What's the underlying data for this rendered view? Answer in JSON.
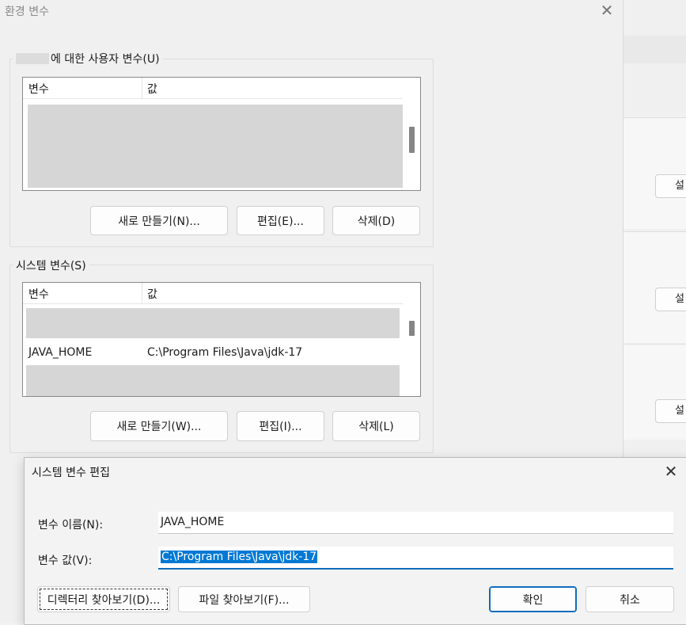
{
  "bg_window": {
    "btn_label": "설"
  },
  "env_dialog": {
    "title": "환경 변수",
    "user_vars": {
      "group_label": "에 대한 사용자 변수(U)",
      "header": {
        "name": "변수",
        "value": "값"
      },
      "buttons": {
        "new": "새로 만들기(N)...",
        "edit": "편집(E)...",
        "delete": "삭제(D)"
      }
    },
    "sys_vars": {
      "group_label": "시스템 변수(S)",
      "header": {
        "name": "변수",
        "value": "값"
      },
      "visible_row": {
        "name": "JAVA_HOME",
        "value": "C:\\Program Files\\Java\\jdk-17"
      },
      "buttons": {
        "new": "새로 만들기(W)...",
        "edit": "편집(I)...",
        "delete": "삭제(L)"
      }
    }
  },
  "edit_dialog": {
    "title": "시스템 변수 편집",
    "name_label": "변수 이름(N):",
    "name_value": "JAVA_HOME",
    "value_label": "변수 값(V):",
    "value_value": "C:\\Program Files\\Java\\jdk-17",
    "buttons": {
      "browse_dir": "디렉터리 찾아보기(D)...",
      "browse_file": "파일 찾아보기(F)...",
      "ok": "확인",
      "cancel": "취소"
    }
  }
}
